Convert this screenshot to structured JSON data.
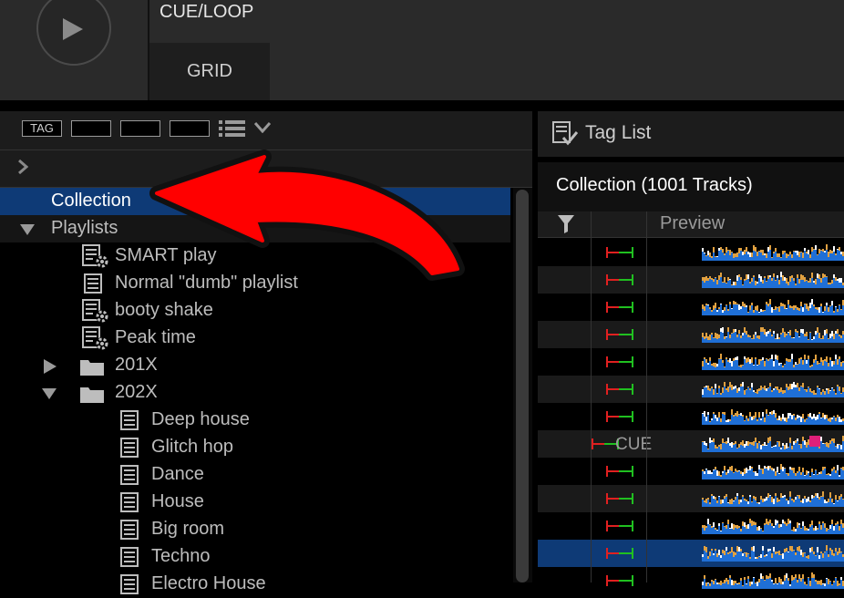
{
  "deck": {
    "cue_loop_label": "CUE/LOOP",
    "grid_tab_label": "GRID",
    "play_icon": "play-icon"
  },
  "left_toolbar": {
    "tag_label": "TAG",
    "list_icon": "list-icon",
    "dropdown_icon": "chevron-down-icon"
  },
  "tree": {
    "collection": "Collection",
    "playlists": "Playlists",
    "items": [
      {
        "label": "SMART play",
        "type": "smart"
      },
      {
        "label": "Normal \"dumb\" playlist",
        "type": "normal"
      },
      {
        "label": "booty shake",
        "type": "smart"
      },
      {
        "label": "Peak time",
        "type": "smart"
      },
      {
        "label": "201X",
        "type": "folder"
      },
      {
        "label": "202X",
        "type": "folder"
      },
      {
        "label": "Deep house",
        "type": "normal"
      },
      {
        "label": "Glitch hop",
        "type": "normal"
      },
      {
        "label": "Dance",
        "type": "normal"
      },
      {
        "label": "House",
        "type": "normal"
      },
      {
        "label": "Big room",
        "type": "normal"
      },
      {
        "label": "Techno",
        "type": "normal"
      },
      {
        "label": "Electro House",
        "type": "normal"
      }
    ]
  },
  "right": {
    "tag_list_title": "Tag List",
    "collection_title": "Collection (1001 Tracks)",
    "preview_column": "Preview",
    "cue_label": "CUE",
    "filter_icon": "filter-icon"
  },
  "colors": {
    "selection": "#0e3a76",
    "arrow": "#ff0000",
    "waveform_blue": "#1f6fd6",
    "waveform_orange": "#e0a040"
  }
}
